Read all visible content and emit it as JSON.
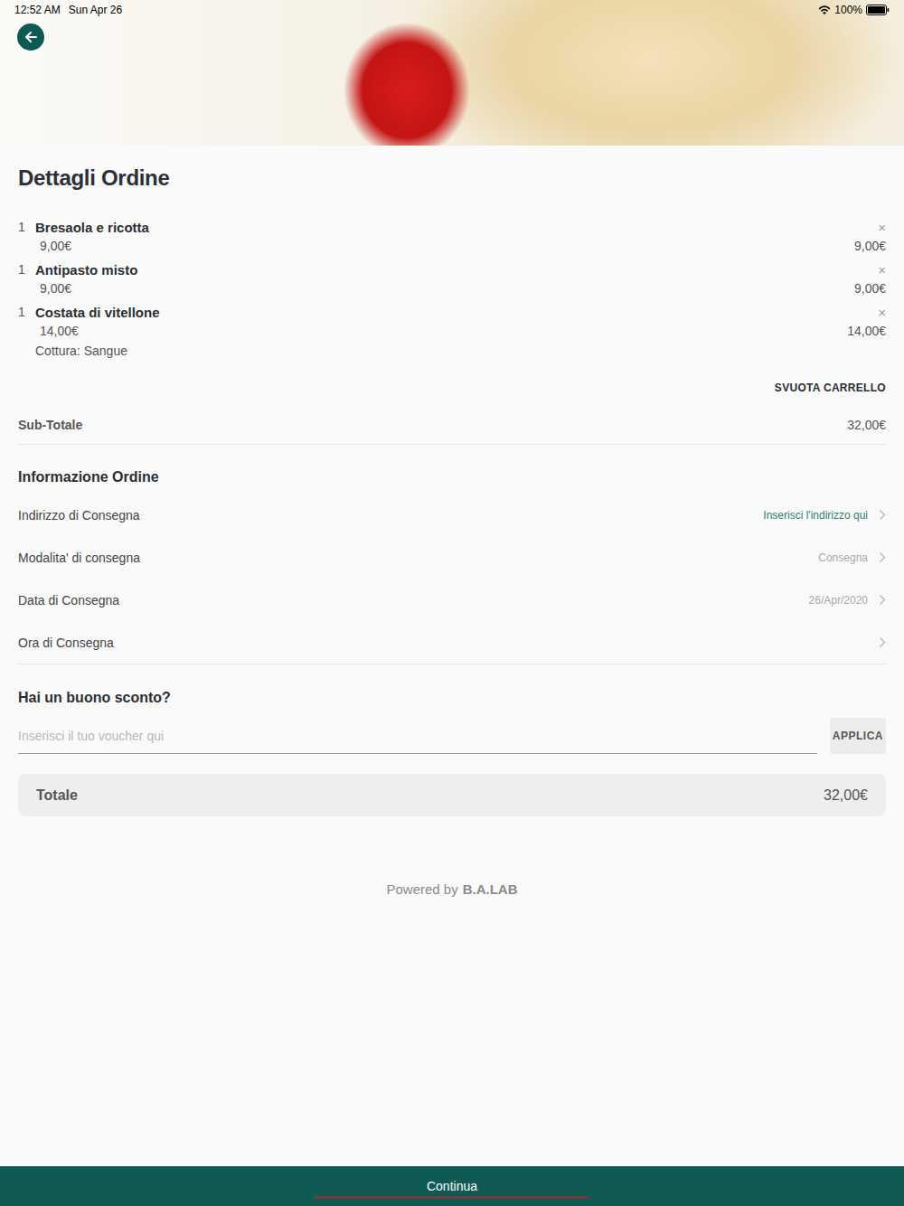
{
  "status_bar": {
    "time": "12:52 AM",
    "date": "Sun Apr 26",
    "battery": "100%"
  },
  "title": "Dettagli Ordine",
  "cart_items": [
    {
      "quantity": "1",
      "name": "Bresaola e ricotta",
      "unit_price": "9,00€",
      "total": "9,00€",
      "remove": "×",
      "options": []
    },
    {
      "quantity": "1",
      "name": "Antipasto misto",
      "unit_price": "9,00€",
      "total": "9,00€",
      "remove": "×",
      "options": []
    },
    {
      "quantity": "1",
      "name": "Costata di vitellone",
      "unit_price": "14,00€",
      "total": "14,00€",
      "remove": "×",
      "options": [
        "Cottura: Sangue"
      ]
    }
  ],
  "clear_cart": "SVUOTA CARRELLO",
  "subtotal": {
    "label": "Sub-Totale",
    "value": "32,00€"
  },
  "order_info": {
    "title": "Informazione Ordine",
    "rows": [
      {
        "label": "Indirizzo di Consegna",
        "value": "Inserisci l'indirizzo qui",
        "highlighted": true
      },
      {
        "label": "Modalita' di consegna",
        "value": "Consegna",
        "highlighted": false
      },
      {
        "label": "Data di Consegna",
        "value": "26/Apr/2020",
        "highlighted": false
      },
      {
        "label": "Ora di Consegna",
        "value": "",
        "highlighted": false
      }
    ]
  },
  "voucher": {
    "title": "Hai un buono sconto?",
    "placeholder": "Inserisci il tuo voucher qui",
    "button": "APPLICA"
  },
  "total": {
    "label": "Totale",
    "value": "32,00€"
  },
  "footer": {
    "powered_by": "Powered by",
    "brand": "B.A.LAB"
  },
  "continue_button": "Continua"
}
